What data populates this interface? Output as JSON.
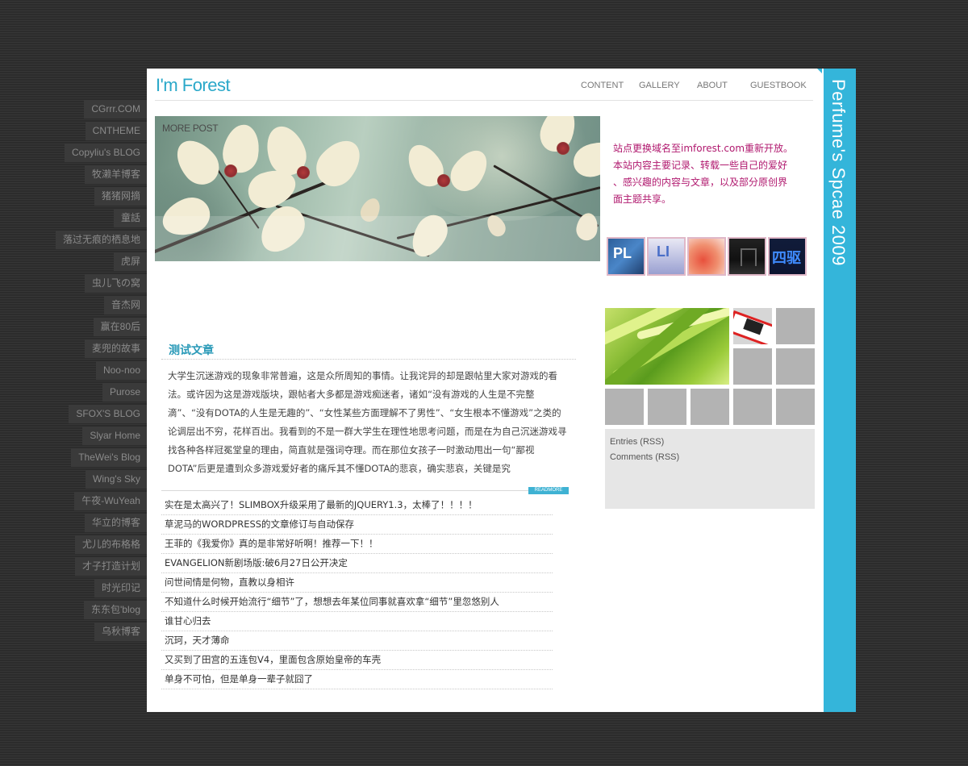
{
  "blogroll": [
    "CGrrr.COM",
    "CNTHEME",
    "Copyliu's BLOG",
    "牧濑羊博客",
    "猪猪网摘",
    "童話",
    "落过无痕的栖息地",
    "虎屏",
    "虫儿飞の窝",
    "音杰网",
    "赢在80后",
    "麦兜的故事",
    "Noo-noo",
    "Purose",
    "SFOX'S BLOG",
    "Slyar Home",
    "TheWei's Blog",
    "Wing's Sky",
    "午夜-WuYeah",
    "华立的博客",
    "尤儿的布格格",
    "才子打造计划",
    "时光印记",
    "东东包'blog",
    "乌秋博客"
  ],
  "logo": {
    "text": "I'm Forest"
  },
  "nav": [
    {
      "label": "CONTENT"
    },
    {
      "label": "GALLERY"
    },
    {
      "label": "ABOUT"
    },
    {
      "label": "GUESTBOOK"
    }
  ],
  "hero": {
    "label": "MORE POST"
  },
  "notice": {
    "lines": [
      "站点更换域名至imforest.com重新开放。",
      "本站内容主要记录、转载一些自己的爱好",
      "、感兴趣的内容与文章，以及部分原创界",
      "面主题共享。"
    ]
  },
  "thumbnails": [
    {
      "label": "PL"
    },
    {
      "label": "LI"
    },
    {
      "label": ""
    },
    {
      "label": ""
    },
    {
      "label": "四驱"
    }
  ],
  "post": {
    "title": "测试文章",
    "body": "大学生沉迷游戏的现象非常普遍，这是众所周知的事情。让我诧异的却是跟帖里大家对游戏的看法。或许因为这是游戏版块，跟帖者大多都是游戏痴迷者，诸如“没有游戏的人生是不完整滴”、“没有DOTA的人生是无趣的”、“女性某些方面理解不了男性”、“女生根本不懂游戏”之类的论调层出不穷，花样百出。我看到的不是一群大学生在理性地思考问题，而是在为自己沉迷游戏寻找各种各样冠冕堂皇的理由，简直就是强词夺理。而在那位女孩子一时激动甩出一句“鄙视DOTA”后更是遭到众多游戏爱好者的痛斥其不懂DOTA的悲哀，确实悲哀，关键是究",
    "readmore": "READMORE"
  },
  "post_list": [
    "实在是太高兴了！SLIMBOX升级采用了最新的JQUERY1.3，太棒了！！！！",
    "草泥马的WORDPRESS的文章修订与自动保存",
    "王菲的《我爱你》真的是非常好听啊！推荐一下！！",
    "EVANGELION新剧场版:破6月27日公开决定",
    "问世间情是何物，直教以身相许",
    "不知道什么时候开始流行“细节”了，想想去年某位同事就喜欢拿“细节”里忽悠别人",
    "谁甘心归去",
    "沉珂，天才薄命",
    "又买到了田宫的五连包V4，里面包含原始皇帝的车壳",
    "单身不可怕，但是单身一辈子就囧了"
  ],
  "rss": {
    "entries": "Entries (RSS)",
    "comments": "Comments (RSS)"
  },
  "sidebar": {
    "title": "Perfume's Spcae 2009"
  },
  "colors": {
    "accent": "#34b5da",
    "notice": "#b0186e",
    "title": "#2a9ab8",
    "background": "#2f2f2f"
  }
}
